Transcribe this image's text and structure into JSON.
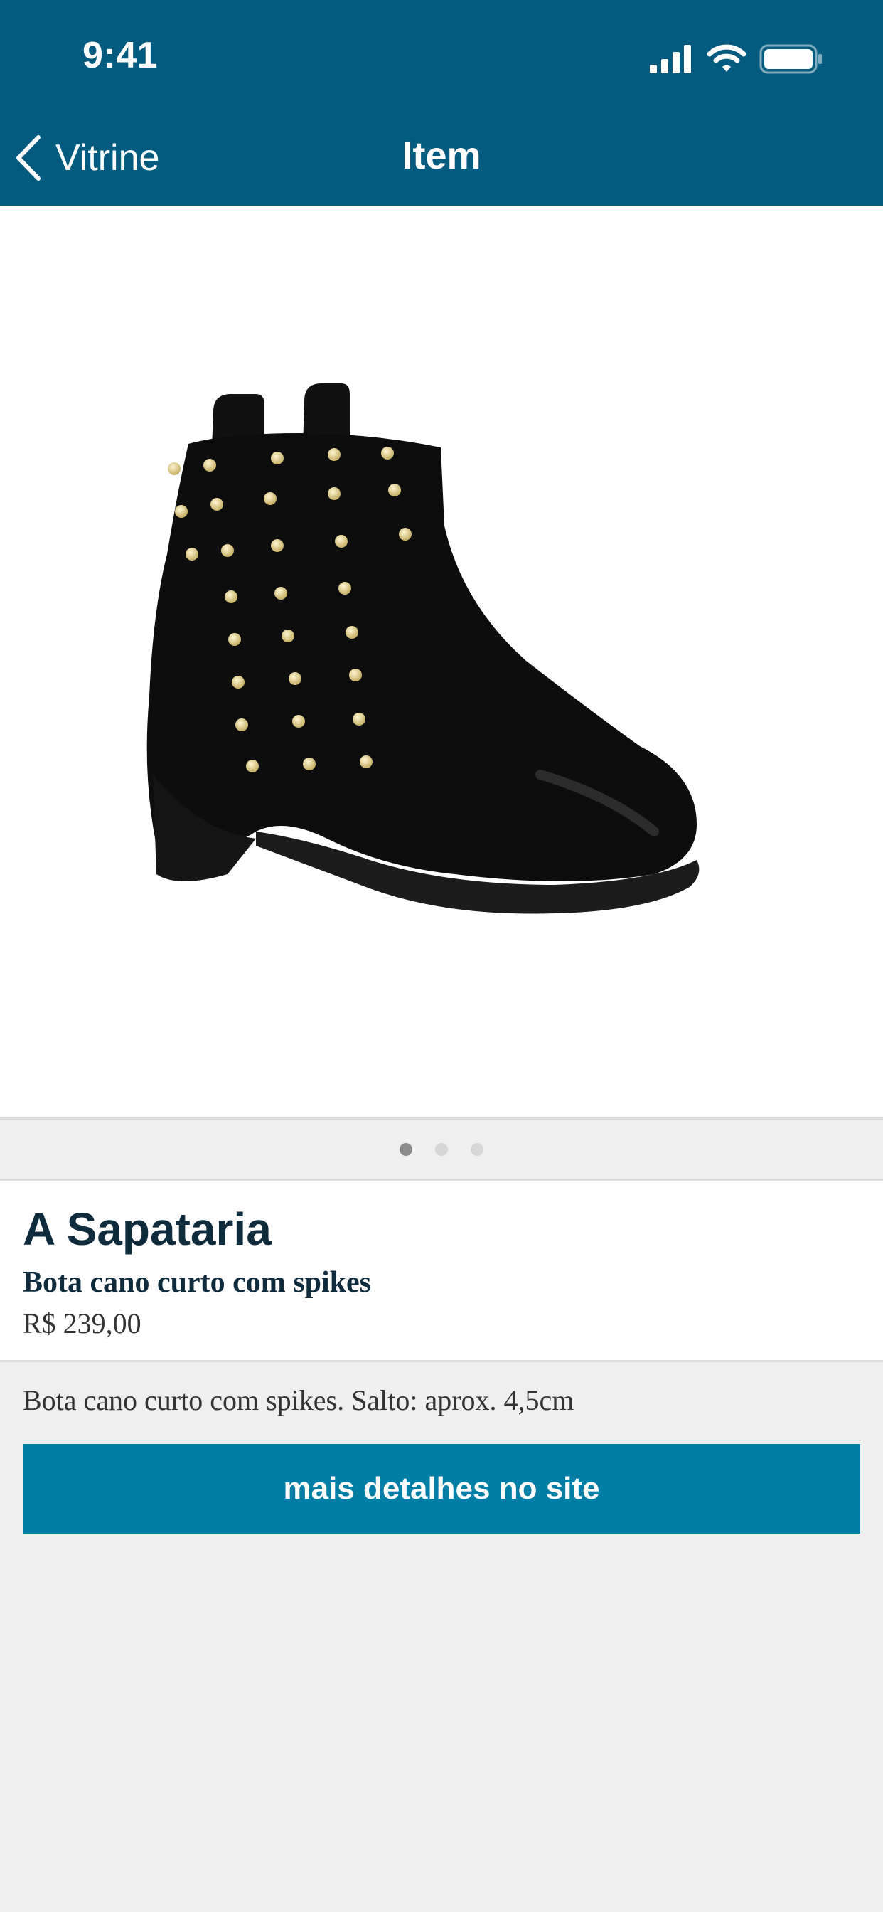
{
  "status_bar": {
    "time": "9:41",
    "icons": [
      "signal-icon",
      "wifi-icon",
      "battery-icon"
    ]
  },
  "nav": {
    "back_label": "Vitrine",
    "title": "Item",
    "back_icon": "chevron-left-icon"
  },
  "product": {
    "image": "black-ankle-boot-with-gold-studs",
    "brand": "A Sapataria",
    "name": "Bota cano curto com spikes",
    "price": "R$ 239,00",
    "description": "Bota cano curto com spikes. Salto: aprox. 4,5cm"
  },
  "pager": {
    "pages": 3,
    "active_index": 0
  },
  "actions": {
    "details_label": "mais detalhes no site"
  },
  "colors": {
    "header": "#035b7f",
    "button": "#007ea5",
    "background": "#efefef",
    "text_dark": "#0f2c3e"
  }
}
